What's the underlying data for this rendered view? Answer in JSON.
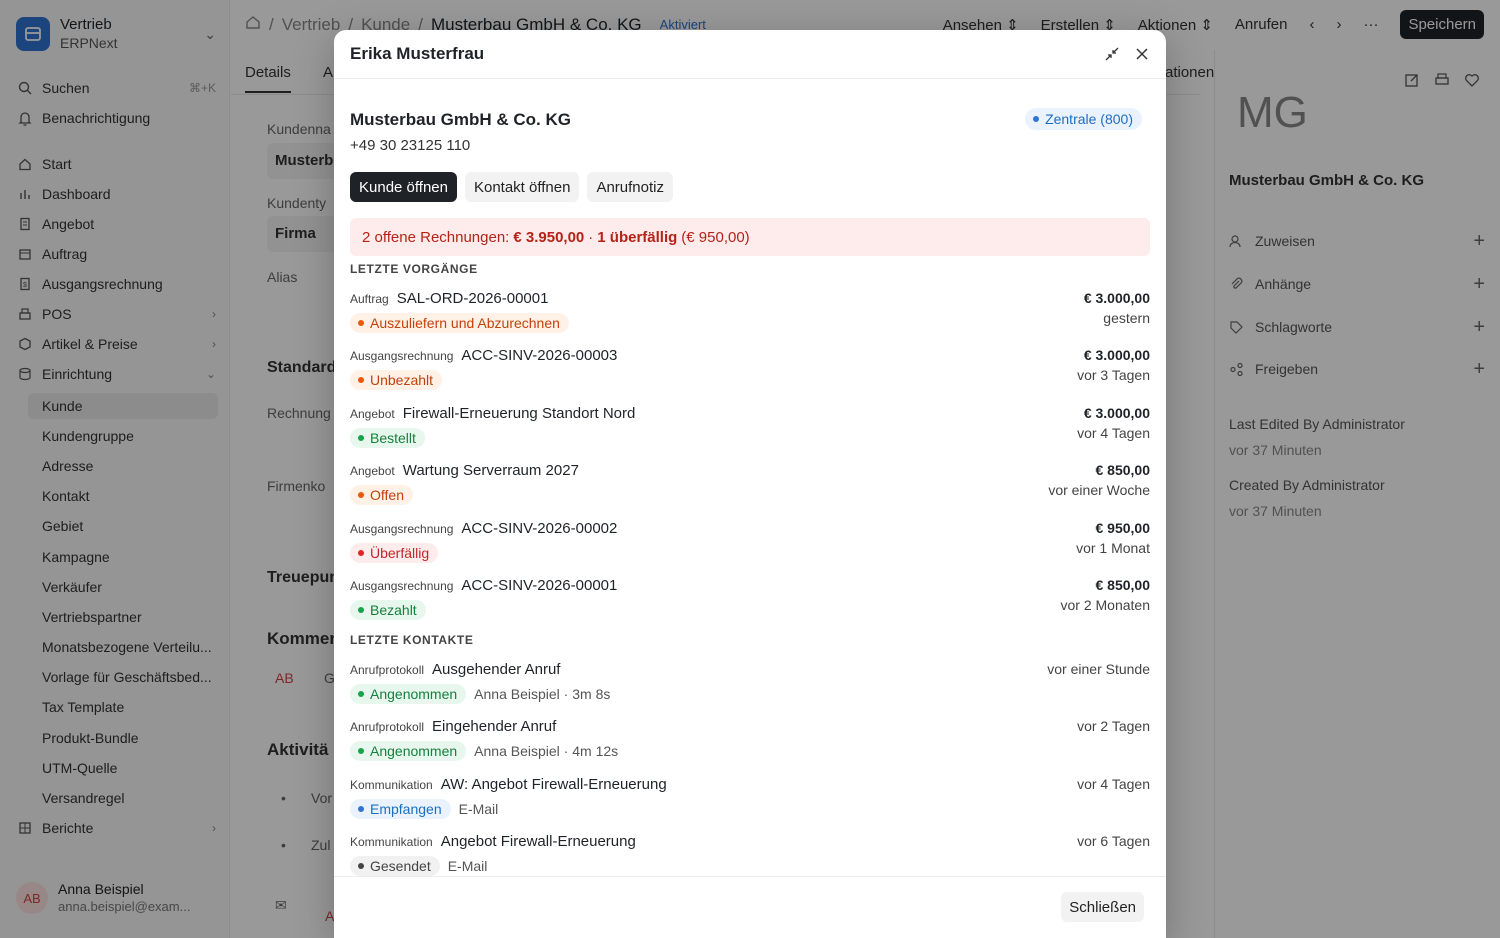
{
  "app": {
    "brand_title": "Vertrieb",
    "brand_subtitle": "ERPNext",
    "search_label": "Suchen",
    "search_shortcut": "⌘+K",
    "notifications_label": "Benachrichtigung",
    "nav": [
      {
        "label": "Start",
        "icon": "home-icon"
      },
      {
        "label": "Dashboard",
        "icon": "bar-chart-icon"
      },
      {
        "label": "Angebot",
        "icon": "document-icon"
      },
      {
        "label": "Auftrag",
        "icon": "clipboard-icon"
      },
      {
        "label": "Ausgangsrechnung",
        "icon": "invoice-icon"
      },
      {
        "label": "POS",
        "icon": "register-icon"
      },
      {
        "label": "Artikel & Preise",
        "icon": "box-icon"
      },
      {
        "label": "Einrichtung",
        "icon": "database-icon"
      }
    ],
    "subnav": [
      "Kunde",
      "Kundengruppe",
      "Adresse",
      "Kontakt",
      "Gebiet",
      "Kampagne",
      "Verkäufer",
      "Vertriebspartner",
      "Monatsbezogene Verteilu...",
      "Vorlage für Geschäftsbed...",
      "Tax Template",
      "Produkt-Bundle",
      "UTM-Quelle",
      "Versandregel"
    ],
    "reports_label": "Berichte",
    "user": {
      "initials": "AB",
      "name": "Anna Beispiel",
      "email": "anna.beispiel@exam..."
    },
    "breadcrumb": [
      "Vertrieb",
      "Kunde",
      "Musterbau GmbH & Co. KG"
    ],
    "doc_status": "Aktiviert",
    "top_actions": [
      "Ansehen",
      "Erstellen",
      "Aktionen"
    ],
    "call_label": "Anrufen",
    "save_label": "Speichern",
    "tabs": [
      "Details",
      "A",
      "ationen"
    ],
    "form": {
      "customer_name_label": "Kundenna",
      "customer_name_value": "Musterb",
      "customer_type_label": "Kundenty",
      "customer_type_value": "Firma",
      "alias_label": "Alias",
      "standard_label": "Standard",
      "invoice_label": "Rechnung",
      "company_label": "Firmenko",
      "loyalty_label": "Treuepun",
      "comments_label": "Komment",
      "comment_avatar": "AB",
      "comment_text": "G",
      "activity_label": "Aktivitä",
      "activity_items": [
        "Vor",
        "Zul"
      ],
      "activity_avatar": "A"
    },
    "right_panel": {
      "initials": "MG",
      "name": "Musterbau GmbH & Co. KG",
      "rows": [
        {
          "label": "Zuweisen",
          "icon": "user-plus-icon"
        },
        {
          "label": "Anhänge",
          "icon": "paperclip-icon"
        },
        {
          "label": "Schlagworte",
          "icon": "tag-icon"
        },
        {
          "label": "Freigeben",
          "icon": "share-icon"
        }
      ],
      "last_edited": "Last Edited By Administrator",
      "last_edited_when": "vor 37 Minuten",
      "created": "Created By Administrator",
      "created_when": "vor 37 Minuten"
    }
  },
  "modal": {
    "title": "Erika Musterfrau",
    "company": "Musterbau GmbH & Co. KG",
    "phone": "+49 30 23125 110",
    "location_badge": "Zentrale (800)",
    "actions": {
      "open_customer": "Kunde öffnen",
      "open_contact": "Kontakt öffnen",
      "call_note": "Anrufnotiz"
    },
    "alert": {
      "prefix": "2 offene Rechnungen:",
      "total": "€ 3.950,00",
      "sep": "·",
      "overdue": "1 überfällig",
      "overdue_amount": "(€ 950,00)"
    },
    "recent_transactions_title": "LETZTE VORGÄNGE",
    "transactions": [
      {
        "kind": "Auftrag",
        "title": "SAL-ORD-2026-00001",
        "status": "Auszuliefern und Abzurechnen",
        "status_color": "orange",
        "amount": "€ 3.000,00",
        "when": "gestern"
      },
      {
        "kind": "Ausgangsrechnung",
        "title": "ACC-SINV-2026-00003",
        "status": "Unbezahlt",
        "status_color": "orange",
        "amount": "€ 3.000,00",
        "when": "vor 3 Tagen"
      },
      {
        "kind": "Angebot",
        "title": "Firewall-Erneuerung Standort Nord",
        "status": "Bestellt",
        "status_color": "green",
        "amount": "€ 3.000,00",
        "when": "vor 4 Tagen"
      },
      {
        "kind": "Angebot",
        "title": "Wartung Serverraum 2027",
        "status": "Offen",
        "status_color": "orange",
        "amount": "€ 850,00",
        "when": "vor einer Woche"
      },
      {
        "kind": "Ausgangsrechnung",
        "title": "ACC-SINV-2026-00002",
        "status": "Überfällig",
        "status_color": "red",
        "amount": "€ 950,00",
        "when": "vor 1 Monat"
      },
      {
        "kind": "Ausgangsrechnung",
        "title": "ACC-SINV-2026-00001",
        "status": "Bezahlt",
        "status_color": "green",
        "amount": "€ 850,00",
        "when": "vor 2 Monaten"
      }
    ],
    "recent_contacts_title": "LETZTE KONTAKTE",
    "contacts": [
      {
        "kind": "Anrufprotokoll",
        "title": "Ausgehender Anruf",
        "status": "Angenommen",
        "status_color": "green",
        "meta": "Anna Beispiel · 3m 8s",
        "when": "vor einer Stunde"
      },
      {
        "kind": "Anrufprotokoll",
        "title": "Eingehender Anruf",
        "status": "Angenommen",
        "status_color": "green",
        "meta": "Anna Beispiel · 4m 12s",
        "when": "vor 2 Tagen"
      },
      {
        "kind": "Kommunikation",
        "title": "AW: Angebot Firewall-Erneuerung",
        "status": "Empfangen",
        "status_color": "blue",
        "meta": "E-Mail",
        "when": "vor 4 Tagen"
      },
      {
        "kind": "Kommunikation",
        "title": "Angebot Firewall-Erneuerung",
        "status": "Gesendet",
        "status_color": "gray",
        "meta": "E-Mail",
        "when": "vor 6 Tagen"
      }
    ],
    "close_label": "Schließen"
  }
}
